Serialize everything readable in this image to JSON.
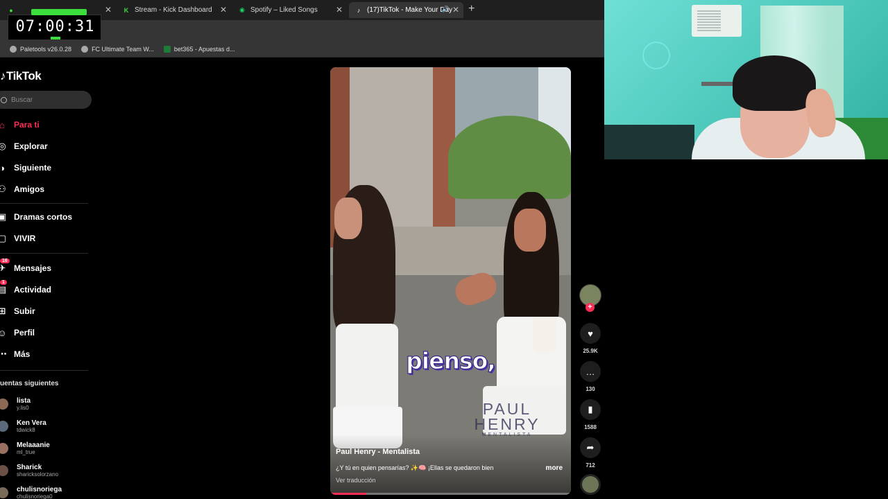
{
  "browser": {
    "tabs": [
      {
        "title": "",
        "icon": "kick-live-icon",
        "color": "#3cde3c"
      },
      {
        "title": "Stream - Kick Dashboard",
        "icon": "kick-icon",
        "color": "#3cde3c"
      },
      {
        "title": "Spotify – Liked Songs",
        "icon": "spotify-icon",
        "color": "#1ed760"
      },
      {
        "title": "(17)TikTok - Make Your Day",
        "icon": "tiktok-icon",
        "color": "#ffffff"
      }
    ],
    "bookmarks": [
      {
        "label": "Paletools v26.0.28"
      },
      {
        "label": "FC Ultimate Team W..."
      },
      {
        "label": "bet365 - Apuestas d..."
      }
    ]
  },
  "stream": {
    "timer": "07:00:31"
  },
  "sidebar": {
    "logo": "TikTok",
    "search_placeholder": "Buscar",
    "nav": [
      {
        "label": "Para ti",
        "icon": "home-icon",
        "active": true
      },
      {
        "label": "Explorar",
        "icon": "compass-icon"
      },
      {
        "label": "Siguiente",
        "icon": "following-icon"
      },
      {
        "label": "Amigos",
        "icon": "friends-icon"
      },
      {
        "label": "Dramas cortos",
        "icon": "drama-icon"
      },
      {
        "label": "VIVIR",
        "icon": "live-icon"
      },
      {
        "label": "Mensajes",
        "icon": "messages-icon",
        "badge": "16"
      },
      {
        "label": "Actividad",
        "icon": "activity-icon",
        "badge": "1"
      },
      {
        "label": "Subir",
        "icon": "upload-icon"
      },
      {
        "label": "Perfil",
        "icon": "profile-icon"
      },
      {
        "label": "Más",
        "icon": "more-icon"
      }
    ],
    "following_title": "uentas siguientes",
    "following": [
      {
        "name": "lista",
        "handle": "y.lis0"
      },
      {
        "name": "Ken Vera",
        "handle": "tdwick8"
      },
      {
        "name": "Melaaanie",
        "handle": "ml_true"
      },
      {
        "name": "Sharick",
        "handle": "sharicksolorzano"
      },
      {
        "name": "chulisnoriega",
        "handle": "chulisnoriega0"
      }
    ]
  },
  "video": {
    "caption_overlay": "pienso,",
    "watermark_main": "PAUL HENRY",
    "watermark_sub": "MENTALISTA",
    "author": "Paul Henry - Mentalista",
    "description": "¿Y tú en quien pensarías? ✨🧠 ¡Ellas se quedaron bien",
    "more_label": "more",
    "translate_label": "Ver traducción",
    "progress": 0.15,
    "accent": "#fe2c55"
  },
  "actions": {
    "likes": "25.9K",
    "comments": "130",
    "saves": "1588",
    "shares": "712"
  }
}
